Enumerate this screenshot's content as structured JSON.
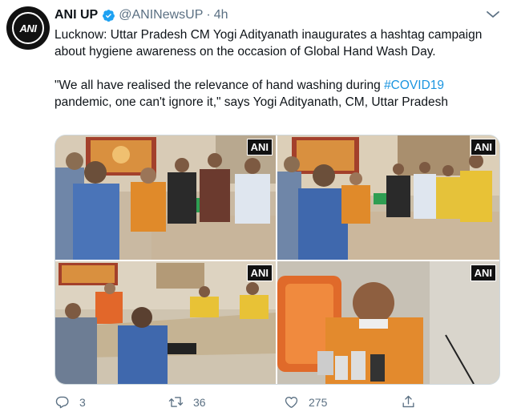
{
  "tweet": {
    "avatar_logo": "ANI",
    "display_name": "ANI UP",
    "handle": "@ANINewsUP",
    "separator": "·",
    "time": "4h",
    "text_line1": "Lucknow: Uttar Pradesh CM Yogi Adityanath inaugurates a hashtag campaign about hygiene awareness on the occasion of Global Hand Wash Day.",
    "text_quote_before": "\"We all have realised the relevance of hand washing during ",
    "hashtag": "#COVID19",
    "text_quote_after": " pandemic, one can't ignore it,\" says Yogi Adityanath, CM, Uttar Pradesh",
    "accent_color": "#1b95e0"
  },
  "media": {
    "photos": [
      {
        "label": "ANI"
      },
      {
        "label": "ANI"
      },
      {
        "label": "ANI"
      },
      {
        "label": "ANI"
      }
    ]
  },
  "actions": {
    "reply_count": "3",
    "retweet_count": "36",
    "like_count": "275"
  }
}
